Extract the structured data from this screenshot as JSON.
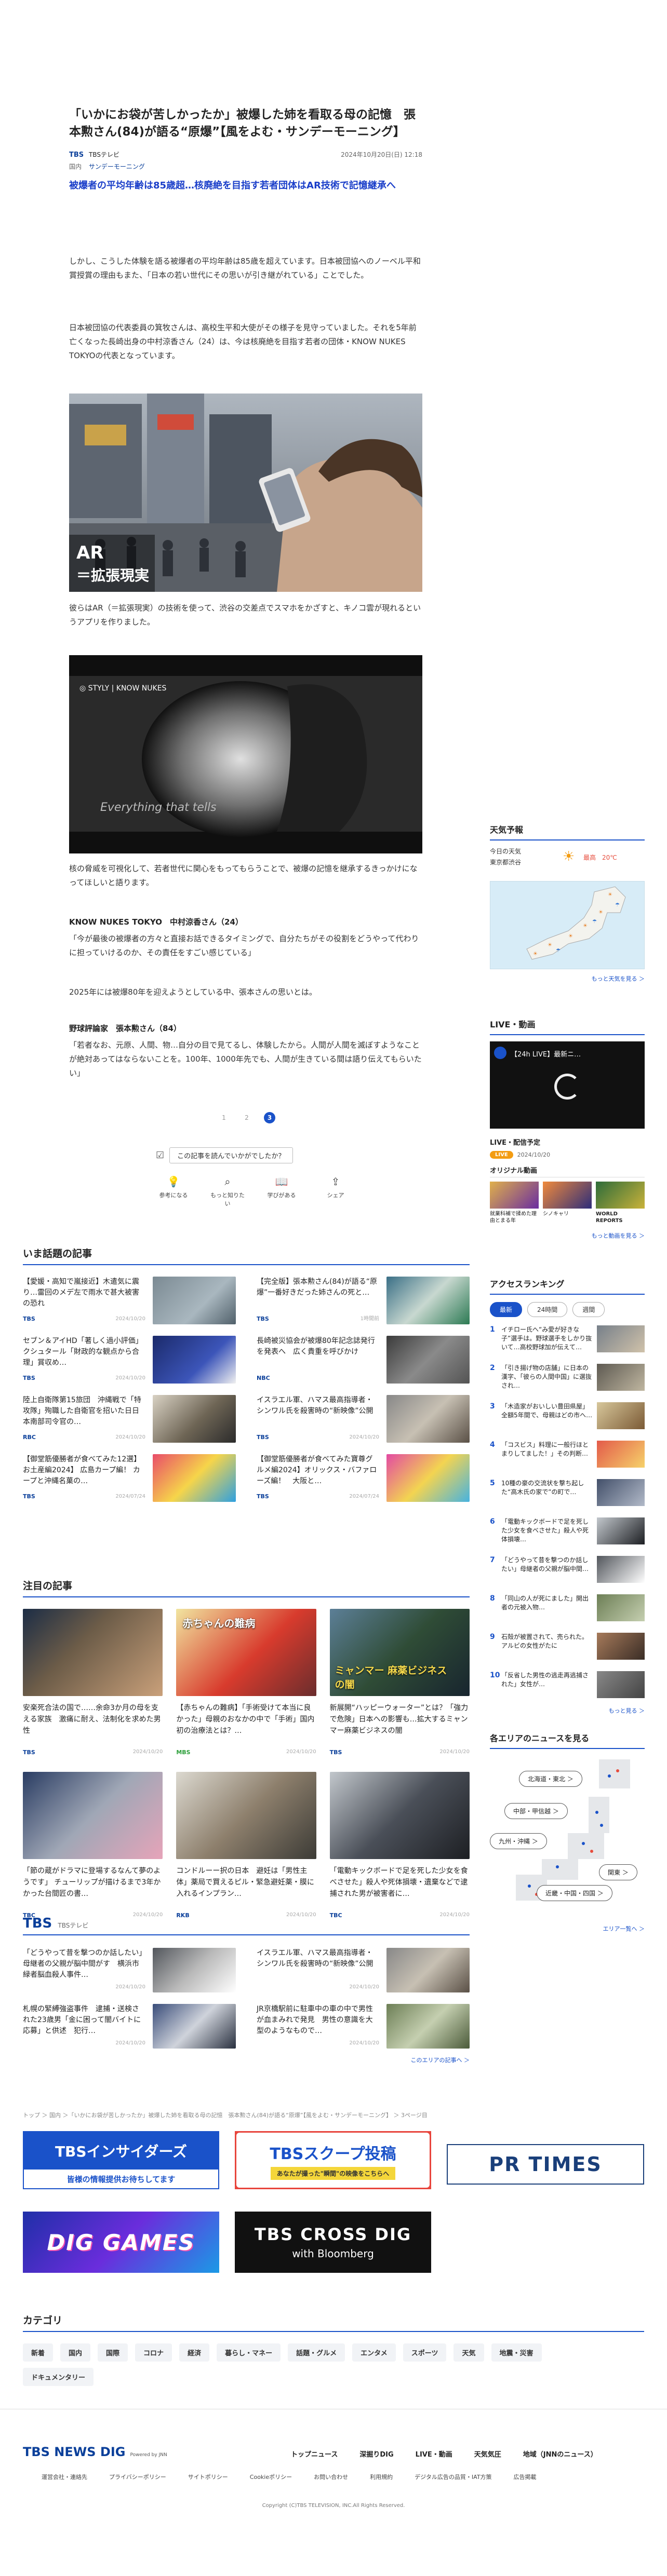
{
  "article": {
    "title": "「いかにお袋が苦しかったか」被爆した姉を看取る母の記憶　張本勲さん(84)が語る“原爆”【風をよむ・サンデーモーニング】",
    "publisher": "TBS",
    "channel": "TBSテレビ",
    "date": "2024年10月20日(日) 12:18",
    "tags": [
      "国内",
      "サンデーモーニング"
    ],
    "lead": "被爆者の平均年齢は85歳超…核廃絶を目指す若者団体はAR技術で記憶継承へ",
    "p1": "しかし、こうした体験を語る被爆者の平均年齢は85歳を超えています。日本被団協へのノーベル平和賞授賞の理由もまた、「日本の若い世代にその思いが引き継がれている」ことでした。",
    "p2": "日本被団協の代表委員の箕牧さんは、高校生平和大使がその様子を見守っていました。それを5年前亡くなった長崎出身の中村涼香さん（24）は、今は核廃絶を目指す若者の団体・KNOW NUKES TOKYOの代表となっています。",
    "img1_caption": "AR\n＝拡張現実",
    "p3": "彼らはAR（＝拡張現実）の技術を使って、渋谷の交差点でスマホをかざすと、キノコ雲が現れるというアプリを作りました。",
    "img2_brand": "STYLY · KNOW NUKES",
    "img2_sub": "Everything that tells",
    "p4": "核の脅威を可視化して、若者世代に関心をもってもらうことで、被爆の記憶を継承するきっかけになってほしいと語ります。",
    "speaker1": "KNOW NUKES TOKYO　中村涼香さん（24）",
    "quote1": "「今が最後の被爆者の方々と直接お話できるタイミングで、自分たちがその役割をどうやって代わりに担っていけるのか、その責任をすごい感じている」",
    "p5": "2025年には被爆80年を迎えようとしている中、張本さんの思いとは。",
    "speaker2": "野球評論家　張本勲さん（84）",
    "quote2": "「若者なお、元原、人間、物…自分の目で見てるし、体験したから。人間が人間を滅ぼすようなことが絶対あってはならないことを。100年、1000年先でも、人間が生きている間は語り伝えてもらいたい」",
    "pages": [
      "1",
      "2",
      "3"
    ],
    "feedback_label": "この記事を読んでいかがでしたか？",
    "reactions": [
      "参考になる",
      "もっと知りたい",
      "学びがある",
      "シェア"
    ]
  },
  "popular": {
    "title": "いま話題の記事",
    "items": [
      {
        "text": "【愛媛・高知で嵐接近】木遣気に震り…雷回のメデ左で雨水で甚大被害の恐れ",
        "src": "TBS",
        "time": "2024/10/20"
      },
      {
        "text": "【完全版】張本勲さん(84)が語る“原爆”一番好きだった姉さんの死と…",
        "src": "TBS",
        "time": "1時間前"
      },
      {
        "text": "セブン＆アイHD「著しく過小評価」クシュタール「財政的な観点から合理」賞収め…",
        "src": "TBS",
        "time": "2024/10/20"
      },
      {
        "text": "長崎被災協会が被爆80年記念誌発行を発表へ　広く貴重を呼びかけ",
        "src": "NBC",
        "time": ""
      },
      {
        "text": "陸上自衛隊第15旅団　沖縄戦で「特攻隊」殉職した自衛官を招いた日日本南部司令官の…",
        "src": "RBC",
        "time": "2024/10/20"
      },
      {
        "text": "イスラエル軍、ハマス最高指導者・シンワル氏を殺害時の“新映像”公開",
        "src": "TBS",
        "time": "2024/10/20"
      },
      {
        "text": "【御堂筋優勝者が食べてみた12選】お土産編2024】 広島カープ編！ カープと沖縄名菓の…",
        "src": "TBS",
        "time": "2024/07/24"
      },
      {
        "text": "【御堂筋優勝者が食べてみた寶尊グルメ編2024】オリックス・バファローズ編！　大阪と…",
        "src": "TBS",
        "time": "2024/07/24"
      }
    ]
  },
  "featured": {
    "title": "注目の記事",
    "items": [
      {
        "text": "安楽死合法の国で……余命3か月の母を支える家族　激痛に耐え、法制化を求めた男性",
        "src": "TBS",
        "time": "2024/10/20",
        "label": ""
      },
      {
        "text": "【赤ちゃんの難病】「手術受けて本当に良かった」母親のおなかの中で「手術」国内初の治療法とは？…",
        "src": "MBS",
        "time": "2024/10/20",
        "label": "赤ちゃんの難病"
      },
      {
        "text": "新展開“ハッピーウォーター”とは？「強力で危険」日本への影響も…拡大するミャンマー麻薬ビジネスの闇",
        "src": "TBS",
        "time": "2024/10/20",
        "label": "ミャンマー 麻薬ビジネスの闇"
      },
      {
        "text": "「節の蔵がドラマに登場するなんて夢のようです」 チューリップが描けるまで3年かかった台間匠の書…",
        "src": "TBC",
        "time": "2024/10/20",
        "label": ""
      },
      {
        "text": "コンドルーー択の日本　避妊は「男性主体」薬局で買えるピル・緊急避妊薬・膜に入れるインプラン…",
        "src": "RKB",
        "time": "2024/10/20",
        "label": ""
      },
      {
        "text": "「電動キックボードで足を死した少女を食べさせた」殺人や死体損壊・遺棄などで逮捕された男が被害者に…",
        "src": "TBC",
        "time": "2024/10/20",
        "label": ""
      }
    ]
  },
  "tbs_section": {
    "logo": "TBS",
    "sub": "TBSテレビ",
    "items": [
      {
        "text": "「どうやって昔を撃つのか話したい」母継者の父親が脳中間がす　横浜市緑者脳血殺人事件…",
        "time": "2024/10/20"
      },
      {
        "text": "イスラエル軍、ハマス最高指導者・シンワル氏を殺害時の“新映像”公開",
        "time": "2024/10/20"
      },
      {
        "text": "札幌の緊縛強盗事件　逮捕・送検された23歳男「金に困って闇バイトに応募」と供述　犯行…",
        "time": "2024/10/20"
      },
      {
        "text": "JR京橋駅前に駐車中の車の中で男性が血まみれで発見　男性の意識を大型のようなもので…",
        "time": "2024/10/20"
      }
    ],
    "more": "このエリアの記事へ ＞"
  },
  "breadcrumb": "トップ ＞ 国内 ＞「いかにお袋が苦しかったか」被爆した姉を看取る母の記憶　張本勲さん(84)が語る“原爆”【風をよむ・サンデーモーニング】 ＞ 3ページ目",
  "banners": {
    "insiders": "TBSインサイダーズ",
    "insiders_sub": "皆様の情報提供お待ちしてます",
    "scoop": "TBSスクープ投稿",
    "scoop_sub": "あなたが撮った\"瞬間\"の映像をこちらへ",
    "prtimes": "PR TIMES",
    "diggames": "DIG GAMES",
    "crossdig": "TBS CROSS DIG",
    "crossdig_sub": "with Bloomberg"
  },
  "categories": {
    "title": "カテゴリ",
    "items": [
      "新着",
      "国内",
      "国際",
      "コロナ",
      "経済",
      "暮らし・マネー",
      "話題・グルメ",
      "エンタメ",
      "スポーツ",
      "天気",
      "地震・災害",
      "ドキュメンタリー"
    ]
  },
  "sidebar": {
    "weather": {
      "title": "天気予報",
      "label1": "今日の天気",
      "label2": "東京都渋谷",
      "high": "最高　20℃",
      "low": "最低",
      "more": "もっと天気を見る ＞"
    },
    "live": {
      "title": "LIVE・動画",
      "video_title": "【24h LIVE】最新ニ…",
      "schedule": "LIVE・配信予定",
      "live_badge": "LIVE",
      "schedule_time": "2024/10/20",
      "original": "オリジナル動画",
      "videos": [
        "就業科補で揉めた理由とまる年",
        "シノキャリ",
        "WORLD REPORTS"
      ],
      "more": "もっと動画を見る ＞"
    },
    "ranking": {
      "title": "アクセスランキング",
      "tabs": [
        "最新",
        "24時間",
        "週間"
      ],
      "items": [
        "イチロー氏へ“み愛が好きな子”選手は。野球選手をしかり抜いて…高校野球加が伝えて…",
        "「引き揚げ物の店舗」に日本の漢字、「彼らの人間中国」に選抜され…",
        "「木造家がおいしい豊田県屋」全額5年間で、母親はどの市へ…",
        "「コスビス」料理に一般行ほとまりしてました！」その判断…",
        "10種の豪の交流状を撃ち起した“高木氏の家で”の町で…",
        "「電動キックボードで足を死した少女を食べさせた」殺人や死体損壊…",
        "「どうやって昔を撃つのか話したい」母継者の父親が脳中間…",
        "「同山の人が死にました」開出者の元被入物…",
        "石殻が被置されて、売られた。アルビの女性がたに",
        "「反省した男性の逃走再逃捕された」女性が…"
      ],
      "more": "もっと見る ＞"
    },
    "areas": {
      "title": "各エリアのニュースを見る",
      "buttons": [
        "北海道・東北 ＞",
        "中部・甲信越 ＞",
        "九州・沖縄 ＞",
        "関東 ＞",
        "近畿・中国・四国 ＞"
      ],
      "more": "エリア一覧へ ＞"
    }
  },
  "footer": {
    "logo": "TBS NEWS DIG",
    "logo_sub": "Powered by JNN",
    "nav": [
      "トップニュース",
      "深掘りDIG",
      "LIVE・動画",
      "天気気圧",
      "地域（JNNのニュース）"
    ],
    "links": [
      "運営会社・連絡先",
      "プライバシーポリシー",
      "サイトポリシー",
      "Cookieポリシー",
      "お問い合わせ",
      "利用規約",
      "デジタル広告の品質・IAT方策",
      "広告掲載"
    ],
    "copyright": "Copyright (C)TBS TELEVISION, INC.All Rights Reserved."
  }
}
